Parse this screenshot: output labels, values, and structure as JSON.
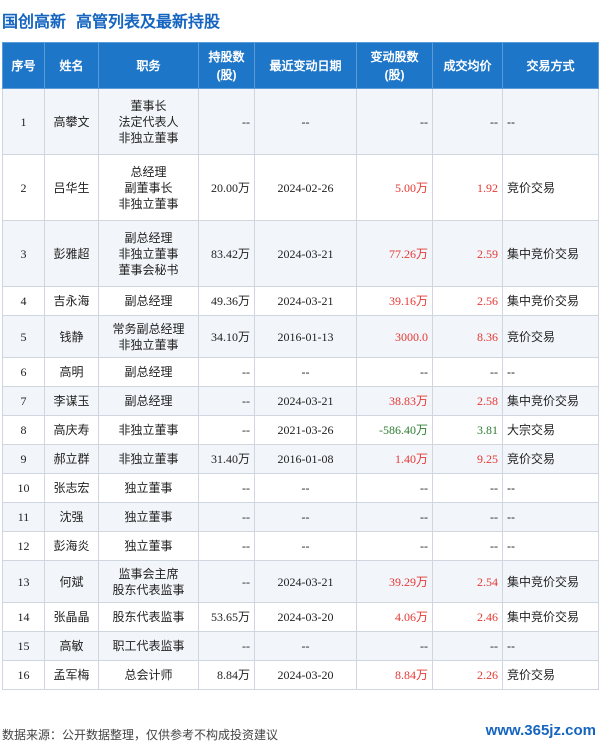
{
  "header": {
    "company": "国创高新",
    "title": "高管列表及最新持股"
  },
  "columns": [
    "序号",
    "姓名",
    "职务",
    "持股数\n(股)",
    "最近变动日期",
    "变动股数\n(股)",
    "成交均价",
    "交易方式"
  ],
  "rows": [
    {
      "idx": "1",
      "name": "高攀文",
      "positions": [
        "董事长",
        "法定代表人",
        "非独立董事"
      ],
      "hold": "--",
      "date": "--",
      "change": "--",
      "price": "--",
      "type": "--"
    },
    {
      "idx": "2",
      "name": "吕华生",
      "positions": [
        "总经理",
        "副董事长",
        "非独立董事"
      ],
      "hold": "20.00万",
      "date": "2024-02-26",
      "change": "5.00万",
      "price": "1.92",
      "type": "竞价交易"
    },
    {
      "idx": "3",
      "name": "彭雅超",
      "positions": [
        "副总经理",
        "非独立董事",
        "董事会秘书"
      ],
      "hold": "83.42万",
      "date": "2024-03-21",
      "change": "77.26万",
      "price": "2.59",
      "type": "集中竞价交易"
    },
    {
      "idx": "4",
      "name": "吉永海",
      "positions": [
        "副总经理"
      ],
      "hold": "49.36万",
      "date": "2024-03-21",
      "change": "39.16万",
      "price": "2.56",
      "type": "集中竞价交易"
    },
    {
      "idx": "5",
      "name": "钱静",
      "positions": [
        "常务副总经理",
        "非独立董事"
      ],
      "hold": "34.10万",
      "date": "2016-01-13",
      "change": "3000.0",
      "price": "8.36",
      "type": "竞价交易"
    },
    {
      "idx": "6",
      "name": "高明",
      "positions": [
        "副总经理"
      ],
      "hold": "--",
      "date": "--",
      "change": "--",
      "price": "--",
      "type": "--"
    },
    {
      "idx": "7",
      "name": "李谋玉",
      "positions": [
        "副总经理"
      ],
      "hold": "--",
      "date": "2024-03-21",
      "change": "38.83万",
      "price": "2.58",
      "type": "集中竞价交易"
    },
    {
      "idx": "8",
      "name": "高庆寿",
      "positions": [
        "非独立董事"
      ],
      "hold": "--",
      "date": "2021-03-26",
      "change": "-586.40万",
      "price": "3.81",
      "type": "大宗交易",
      "negative": true
    },
    {
      "idx": "9",
      "name": "郝立群",
      "positions": [
        "非独立董事"
      ],
      "hold": "31.40万",
      "date": "2016-01-08",
      "change": "1.40万",
      "price": "9.25",
      "type": "竞价交易"
    },
    {
      "idx": "10",
      "name": "张志宏",
      "positions": [
        "独立董事"
      ],
      "hold": "--",
      "date": "--",
      "change": "--",
      "price": "--",
      "type": "--"
    },
    {
      "idx": "11",
      "name": "沈强",
      "positions": [
        "独立董事"
      ],
      "hold": "--",
      "date": "--",
      "change": "--",
      "price": "--",
      "type": "--"
    },
    {
      "idx": "12",
      "name": "彭海炎",
      "positions": [
        "独立董事"
      ],
      "hold": "--",
      "date": "--",
      "change": "--",
      "price": "--",
      "type": "--"
    },
    {
      "idx": "13",
      "name": "何斌",
      "positions": [
        "监事会主席",
        "股东代表监事"
      ],
      "hold": "--",
      "date": "2024-03-21",
      "change": "39.29万",
      "price": "2.54",
      "type": "集中竞价交易"
    },
    {
      "idx": "14",
      "name": "张晶晶",
      "positions": [
        "股东代表监事"
      ],
      "hold": "53.65万",
      "date": "2024-03-20",
      "change": "4.06万",
      "price": "2.46",
      "type": "集中竞价交易"
    },
    {
      "idx": "15",
      "name": "高敏",
      "positions": [
        "职工代表监事"
      ],
      "hold": "--",
      "date": "--",
      "change": "--",
      "price": "--",
      "type": "--"
    },
    {
      "idx": "16",
      "name": "孟军梅",
      "positions": [
        "总会计师"
      ],
      "hold": "8.84万",
      "date": "2024-03-20",
      "change": "8.84万",
      "price": "2.26",
      "type": "竞价交易"
    }
  ],
  "footer": {
    "source": "数据来源：公开数据整理，仅供参考不构成投资建议",
    "site": "www.365jz.com"
  },
  "colors": {
    "header_bg": "#1e76c8",
    "title": "#1565c0",
    "positive": "#e53935",
    "negative": "#2e7d32"
  }
}
